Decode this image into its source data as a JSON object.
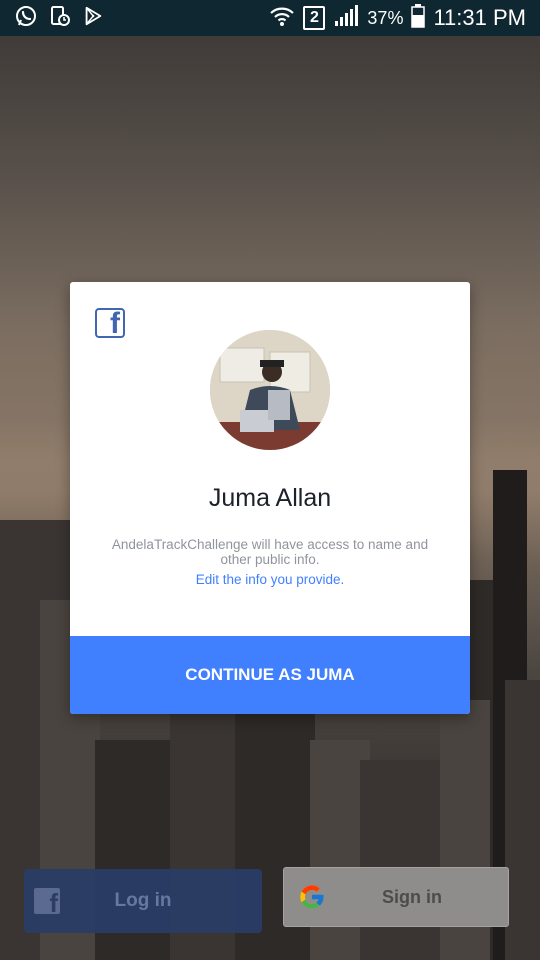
{
  "status_bar": {
    "battery": "37%",
    "sim": "2",
    "time": "11:31 PM",
    "icons": [
      "whatsapp-icon",
      "phone-usage-icon",
      "play-store-icon",
      "wifi-icon",
      "signal-icon",
      "battery-icon"
    ]
  },
  "dialog": {
    "brand_icon": "facebook-icon",
    "user_name": "Juma Allan",
    "access_text": "AndelaTrackChallenge will have access to name and other public info.",
    "edit_link": "Edit the info you provide.",
    "continue_label": "CONTINUE AS JUMA"
  },
  "bottom": {
    "facebook_login_label": "Log in",
    "google_signin_label": "Sign in"
  },
  "colors": {
    "status_bar": "#0f2730",
    "facebook_blue": "#4267b2",
    "continue_blue": "#4080ff"
  }
}
